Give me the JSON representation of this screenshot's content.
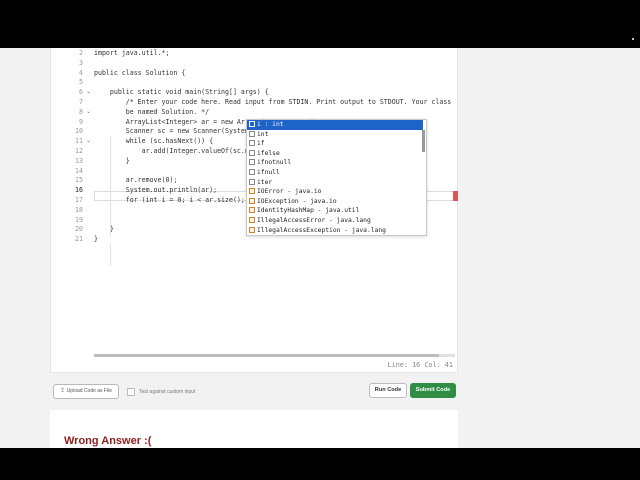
{
  "editor": {
    "line_numbers": [
      "2",
      "3",
      "4",
      "5",
      "6",
      "7",
      "8",
      "9",
      "10",
      "11",
      "12",
      "13",
      "14",
      "15",
      "16",
      "17",
      "18",
      "19",
      "20",
      "21"
    ],
    "current_line": "16",
    "fold_markers": {
      "5": "⌄",
      "7": "⌄",
      "10": "⌄"
    },
    "lines": [
      "import java.util.*;",
      "",
      "public class Solution {",
      "",
      "    public static void main(String[] args) {",
      "        /* Enter your code here. Read input from STDIN. Print output to STDOUT. Your class should",
      "        be named Solution. */",
      "        ArrayList<Integer> ar = new ArrayList<Integer>();",
      "        Scanner sc = new Scanner(System.in);",
      "        while (sc.hasNext()) {",
      "            ar.add(Integer.valueOf(sc.nextInt()));",
      "        }",
      "",
      "        ar.remove(0);",
      "        System.out.println(ar);",
      "        for (int i = 0; i < ar.size(); i",
      "",
      "",
      "    }",
      "}"
    ],
    "status": "Line: 16 Col: 41"
  },
  "autocomplete": {
    "items": [
      {
        "label": "i : int",
        "kind": "var"
      },
      {
        "label": "int",
        "kind": "var"
      },
      {
        "label": "if",
        "kind": "tpl"
      },
      {
        "label": "ifelse",
        "kind": "tpl"
      },
      {
        "label": "ifnotnull",
        "kind": "tpl"
      },
      {
        "label": "ifnull",
        "kind": "tpl"
      },
      {
        "label": "iter",
        "kind": "tpl"
      },
      {
        "label": "IOError - java.io",
        "kind": "cls"
      },
      {
        "label": "IOException - java.io",
        "kind": "cls"
      },
      {
        "label": "IdentityHashMap - java.util",
        "kind": "cls"
      },
      {
        "label": "IllegalAccessError - java.lang",
        "kind": "cls"
      },
      {
        "label": "IllegalAccessException - java.lang",
        "kind": "cls"
      }
    ],
    "selected_index": 0
  },
  "controls": {
    "upload_label": "Upload Code as File",
    "custom_input_label": "Test against custom input",
    "run_label": "Run Code",
    "submit_label": "Submit Code",
    "submit_color": "#2f8d46"
  },
  "result": {
    "title": "Wrong Answer :("
  }
}
